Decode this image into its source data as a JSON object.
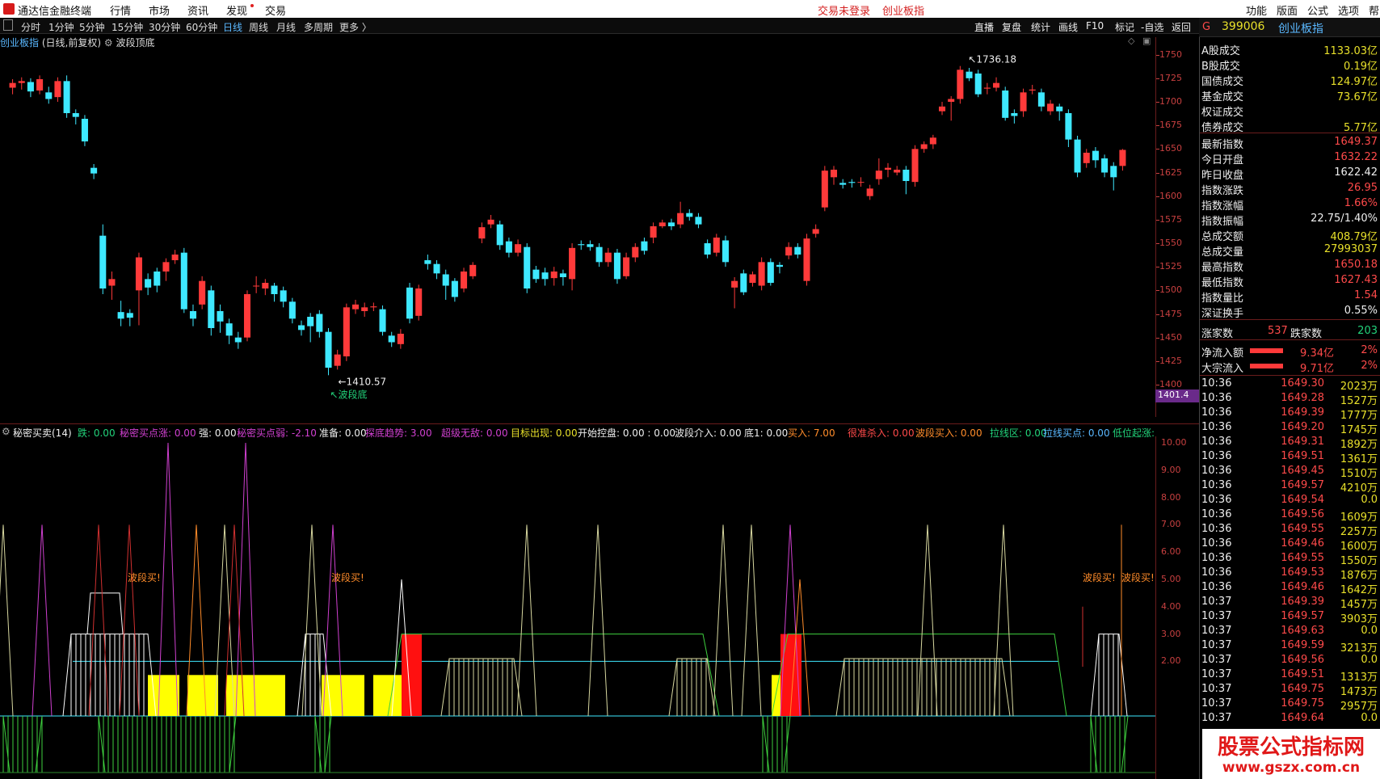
{
  "topbar": {
    "app_name": "通达信金融终端",
    "menus": [
      "行情",
      "市场",
      "资讯",
      "发现",
      "交易"
    ],
    "status_left": "交易未登录",
    "status_right": "创业板指",
    "right_menus": [
      "功能",
      "版面",
      "公式",
      "选项",
      "帮"
    ]
  },
  "periods": {
    "items": [
      "分时",
      "1分钟",
      "5分钟",
      "15分钟",
      "30分钟",
      "60分钟",
      "日线",
      "周线",
      "月线",
      "多周期",
      "更多 〉"
    ],
    "active": "日线"
  },
  "tools": [
    "直播",
    "复盘",
    "统计",
    "画线",
    "F10",
    "标记",
    "-自选",
    "返回"
  ],
  "main_chart": {
    "title_name": "创业板指",
    "title_mode": "(日线,前复权)",
    "indicator": "波段顶底",
    "high_label": "1736.18",
    "low_label": "1410.57",
    "low_note": "↖波段底",
    "price_marker": "1401.4",
    "y_labels": [
      "1750",
      "1725",
      "1700",
      "1675",
      "1650",
      "1625",
      "1600",
      "1575",
      "1550",
      "1525",
      "1500",
      "1475",
      "1450",
      "1425",
      "1400"
    ]
  },
  "chart_data": {
    "type": "candlestick",
    "ylim": [
      1400,
      1760
    ],
    "candles": [
      {
        "o": 1715,
        "c": 1720,
        "h": 1724,
        "l": 1708
      },
      {
        "o": 1720,
        "c": 1722,
        "h": 1726,
        "l": 1713
      },
      {
        "o": 1721,
        "c": 1711,
        "h": 1725,
        "l": 1705
      },
      {
        "o": 1712,
        "c": 1724,
        "h": 1728,
        "l": 1708
      },
      {
        "o": 1710,
        "c": 1703,
        "h": 1716,
        "l": 1698
      },
      {
        "o": 1705,
        "c": 1722,
        "h": 1726,
        "l": 1700
      },
      {
        "o": 1722,
        "c": 1688,
        "h": 1728,
        "l": 1683
      },
      {
        "o": 1688,
        "c": 1684,
        "h": 1692,
        "l": 1676
      },
      {
        "o": 1682,
        "c": 1658,
        "h": 1686,
        "l": 1653
      },
      {
        "o": 1630,
        "c": 1624,
        "h": 1634,
        "l": 1618
      },
      {
        "o": 1558,
        "c": 1502,
        "h": 1570,
        "l": 1496
      },
      {
        "o": 1505,
        "c": 1512,
        "h": 1520,
        "l": 1490
      },
      {
        "o": 1477,
        "c": 1470,
        "h": 1489,
        "l": 1462
      },
      {
        "o": 1476,
        "c": 1471,
        "h": 1480,
        "l": 1462
      },
      {
        "o": 1500,
        "c": 1535,
        "h": 1540,
        "l": 1463
      },
      {
        "o": 1512,
        "c": 1503,
        "h": 1518,
        "l": 1495
      },
      {
        "o": 1520,
        "c": 1505,
        "h": 1524,
        "l": 1498
      },
      {
        "o": 1520,
        "c": 1530,
        "h": 1534,
        "l": 1510
      },
      {
        "o": 1532,
        "c": 1538,
        "h": 1543,
        "l": 1528
      },
      {
        "o": 1540,
        "c": 1480,
        "h": 1545,
        "l": 1476
      },
      {
        "o": 1478,
        "c": 1470,
        "h": 1485,
        "l": 1462
      },
      {
        "o": 1485,
        "c": 1510,
        "h": 1515,
        "l": 1480
      },
      {
        "o": 1500,
        "c": 1460,
        "h": 1505,
        "l": 1452
      },
      {
        "o": 1478,
        "c": 1467,
        "h": 1485,
        "l": 1455
      },
      {
        "o": 1465,
        "c": 1452,
        "h": 1470,
        "l": 1443
      },
      {
        "o": 1450,
        "c": 1445,
        "h": 1456,
        "l": 1438
      },
      {
        "o": 1450,
        "c": 1496,
        "h": 1500,
        "l": 1446
      },
      {
        "o": 1505,
        "c": 1505,
        "h": 1515,
        "l": 1497
      },
      {
        "o": 1502,
        "c": 1508,
        "h": 1512,
        "l": 1495
      },
      {
        "o": 1505,
        "c": 1496,
        "h": 1508,
        "l": 1488
      },
      {
        "o": 1500,
        "c": 1488,
        "h": 1504,
        "l": 1482
      },
      {
        "o": 1488,
        "c": 1470,
        "h": 1492,
        "l": 1465
      },
      {
        "o": 1463,
        "c": 1458,
        "h": 1468,
        "l": 1452
      },
      {
        "o": 1472,
        "c": 1462,
        "h": 1476,
        "l": 1445
      },
      {
        "o": 1475,
        "c": 1456,
        "h": 1479,
        "l": 1450
      },
      {
        "o": 1456,
        "c": 1418,
        "h": 1460,
        "l": 1410
      },
      {
        "o": 1420,
        "c": 1432,
        "h": 1437,
        "l": 1416
      },
      {
        "o": 1430,
        "c": 1482,
        "h": 1486,
        "l": 1425
      },
      {
        "o": 1480,
        "c": 1485,
        "h": 1490,
        "l": 1475
      },
      {
        "o": 1478,
        "c": 1482,
        "h": 1487,
        "l": 1472
      },
      {
        "o": 1482,
        "c": 1483,
        "h": 1487,
        "l": 1478
      },
      {
        "o": 1480,
        "c": 1456,
        "h": 1484,
        "l": 1452
      },
      {
        "o": 1452,
        "c": 1445,
        "h": 1456,
        "l": 1440
      },
      {
        "o": 1443,
        "c": 1454,
        "h": 1459,
        "l": 1438
      },
      {
        "o": 1503,
        "c": 1470,
        "h": 1508,
        "l": 1465
      },
      {
        "o": 1473,
        "c": 1502,
        "h": 1506,
        "l": 1468
      },
      {
        "o": 1532,
        "c": 1528,
        "h": 1538,
        "l": 1522
      },
      {
        "o": 1528,
        "c": 1518,
        "h": 1532,
        "l": 1512
      },
      {
        "o": 1517,
        "c": 1505,
        "h": 1522,
        "l": 1490
      },
      {
        "o": 1510,
        "c": 1493,
        "h": 1513,
        "l": 1488
      },
      {
        "o": 1502,
        "c": 1520,
        "h": 1524,
        "l": 1498
      },
      {
        "o": 1515,
        "c": 1527,
        "h": 1530,
        "l": 1512
      },
      {
        "o": 1555,
        "c": 1567,
        "h": 1572,
        "l": 1550
      },
      {
        "o": 1570,
        "c": 1575,
        "h": 1580,
        "l": 1566
      },
      {
        "o": 1570,
        "c": 1548,
        "h": 1574,
        "l": 1543
      },
      {
        "o": 1552,
        "c": 1540,
        "h": 1556,
        "l": 1535
      },
      {
        "o": 1540,
        "c": 1549,
        "h": 1554,
        "l": 1536
      },
      {
        "o": 1546,
        "c": 1502,
        "h": 1550,
        "l": 1497
      },
      {
        "o": 1522,
        "c": 1512,
        "h": 1526,
        "l": 1508
      },
      {
        "o": 1519,
        "c": 1512,
        "h": 1524,
        "l": 1505
      },
      {
        "o": 1513,
        "c": 1520,
        "h": 1525,
        "l": 1505
      },
      {
        "o": 1518,
        "c": 1514,
        "h": 1522,
        "l": 1505
      },
      {
        "o": 1512,
        "c": 1545,
        "h": 1550,
        "l": 1500
      },
      {
        "o": 1549,
        "c": 1548,
        "h": 1553,
        "l": 1543
      },
      {
        "o": 1549,
        "c": 1546,
        "h": 1553,
        "l": 1542
      },
      {
        "o": 1546,
        "c": 1530,
        "h": 1550,
        "l": 1525
      },
      {
        "o": 1530,
        "c": 1540,
        "h": 1545,
        "l": 1525
      },
      {
        "o": 1540,
        "c": 1512,
        "h": 1544,
        "l": 1507
      },
      {
        "o": 1515,
        "c": 1535,
        "h": 1540,
        "l": 1512
      },
      {
        "o": 1535,
        "c": 1546,
        "h": 1550,
        "l": 1530
      },
      {
        "o": 1552,
        "c": 1542,
        "h": 1556,
        "l": 1538
      },
      {
        "o": 1556,
        "c": 1568,
        "h": 1572,
        "l": 1550
      },
      {
        "o": 1568,
        "c": 1572,
        "h": 1575,
        "l": 1566
      },
      {
        "o": 1572,
        "c": 1568,
        "h": 1576,
        "l": 1564
      },
      {
        "o": 1570,
        "c": 1582,
        "h": 1594,
        "l": 1566
      },
      {
        "o": 1582,
        "c": 1578,
        "h": 1586,
        "l": 1574
      },
      {
        "o": 1578,
        "c": 1570,
        "h": 1582,
        "l": 1566
      },
      {
        "o": 1550,
        "c": 1538,
        "h": 1554,
        "l": 1534
      },
      {
        "o": 1540,
        "c": 1556,
        "h": 1560,
        "l": 1536
      },
      {
        "o": 1553,
        "c": 1530,
        "h": 1558,
        "l": 1525
      },
      {
        "o": 1503,
        "c": 1510,
        "h": 1514,
        "l": 1481
      },
      {
        "o": 1518,
        "c": 1498,
        "h": 1522,
        "l": 1495
      },
      {
        "o": 1508,
        "c": 1517,
        "h": 1520,
        "l": 1504
      },
      {
        "o": 1505,
        "c": 1530,
        "h": 1535,
        "l": 1500
      },
      {
        "o": 1530,
        "c": 1508,
        "h": 1534,
        "l": 1505
      },
      {
        "o": 1527,
        "c": 1525,
        "h": 1530,
        "l": 1518
      },
      {
        "o": 1537,
        "c": 1546,
        "h": 1551,
        "l": 1533
      },
      {
        "o": 1546,
        "c": 1538,
        "h": 1550,
        "l": 1534
      },
      {
        "o": 1510,
        "c": 1555,
        "h": 1560,
        "l": 1505
      },
      {
        "o": 1560,
        "c": 1565,
        "h": 1570,
        "l": 1556
      },
      {
        "o": 1588,
        "c": 1627,
        "h": 1632,
        "l": 1584
      },
      {
        "o": 1620,
        "c": 1628,
        "h": 1632,
        "l": 1612
      },
      {
        "o": 1614,
        "c": 1612,
        "h": 1618,
        "l": 1608
      },
      {
        "o": 1615,
        "c": 1614,
        "h": 1618,
        "l": 1609
      },
      {
        "o": 1615,
        "c": 1615,
        "h": 1620,
        "l": 1610
      },
      {
        "o": 1600,
        "c": 1608,
        "h": 1612,
        "l": 1596
      },
      {
        "o": 1618,
        "c": 1627,
        "h": 1640,
        "l": 1612
      },
      {
        "o": 1628,
        "c": 1630,
        "h": 1635,
        "l": 1620
      },
      {
        "o": 1625,
        "c": 1628,
        "h": 1632,
        "l": 1622
      },
      {
        "o": 1628,
        "c": 1616,
        "h": 1632,
        "l": 1602
      },
      {
        "o": 1615,
        "c": 1650,
        "h": 1654,
        "l": 1610
      },
      {
        "o": 1650,
        "c": 1655,
        "h": 1658,
        "l": 1646
      },
      {
        "o": 1655,
        "c": 1662,
        "h": 1665,
        "l": 1650
      },
      {
        "o": 1690,
        "c": 1695,
        "h": 1700,
        "l": 1686
      },
      {
        "o": 1700,
        "c": 1703,
        "h": 1706,
        "l": 1680
      },
      {
        "o": 1703,
        "c": 1734,
        "h": 1738,
        "l": 1698
      },
      {
        "o": 1732,
        "c": 1725,
        "h": 1736,
        "l": 1722
      },
      {
        "o": 1730,
        "c": 1708,
        "h": 1734,
        "l": 1705
      },
      {
        "o": 1714,
        "c": 1715,
        "h": 1720,
        "l": 1708
      },
      {
        "o": 1715,
        "c": 1720,
        "h": 1726,
        "l": 1711
      },
      {
        "o": 1712,
        "c": 1683,
        "h": 1716,
        "l": 1680
      },
      {
        "o": 1688,
        "c": 1685,
        "h": 1692,
        "l": 1677
      },
      {
        "o": 1690,
        "c": 1710,
        "h": 1714,
        "l": 1684
      },
      {
        "o": 1712,
        "c": 1713,
        "h": 1718,
        "l": 1708
      },
      {
        "o": 1710,
        "c": 1695,
        "h": 1714,
        "l": 1690
      },
      {
        "o": 1690,
        "c": 1698,
        "h": 1702,
        "l": 1686
      },
      {
        "o": 1695,
        "c": 1690,
        "h": 1698,
        "l": 1680
      },
      {
        "o": 1688,
        "c": 1660,
        "h": 1692,
        "l": 1652
      },
      {
        "o": 1660,
        "c": 1625,
        "h": 1664,
        "l": 1620
      },
      {
        "o": 1635,
        "c": 1646,
        "h": 1650,
        "l": 1630
      },
      {
        "o": 1648,
        "c": 1638,
        "h": 1652,
        "l": 1630
      },
      {
        "o": 1640,
        "c": 1625,
        "h": 1644,
        "l": 1620
      },
      {
        "o": 1632,
        "c": 1620,
        "h": 1636,
        "l": 1606
      },
      {
        "o": 1632,
        "c": 1649,
        "h": 1650,
        "l": 1627
      }
    ]
  },
  "indicator": {
    "title": "秘密买卖(14)",
    "legend": [
      {
        "t": "跌: 0.00",
        "c": "#22d27a"
      },
      {
        "t": "秘密买点涨: 0.00",
        "c": "#d040d0"
      },
      {
        "t": "强: 0.00",
        "c": "#eee"
      },
      {
        "t": "秘密买点弱: -2.10",
        "c": "#d040d0"
      },
      {
        "t": "准备: 0.00",
        "c": "#eee"
      },
      {
        "t": "探底趋势: 3.00",
        "c": "#d040d0"
      },
      {
        "t": "超级无敌: 0.00",
        "c": "#d040d0"
      },
      {
        "t": "目标出现: 0.00",
        "c": "#e8e02a"
      },
      {
        "t": "开始控盘: 0.00 : 0.00",
        "c": "#eee"
      },
      {
        "t": "波段介入: 0.00",
        "c": "#eee"
      },
      {
        "t": "底1: 0.00",
        "c": "#eee"
      },
      {
        "t": "买入: 7.00",
        "c": "#ff8c2a"
      },
      {
        "t": "很准杀入: 0.00",
        "c": "#ff4a4a"
      },
      {
        "t": "波段买入: 0.00",
        "c": "#ff8c2a"
      },
      {
        "t": "拉线区: 0.00",
        "c": "#22d27a"
      },
      {
        "t": "拉线买点: 0.00",
        "c": "#5ab8ff"
      },
      {
        "t": "低位起涨:",
        "c": "#22d27a"
      }
    ],
    "buy_labels": [
      "波段买!",
      "波段买!",
      "波段买!",
      "波段买!"
    ],
    "y_labels": [
      "10.00",
      "9.00",
      "8.00",
      "7.00",
      "6.00",
      "5.00",
      "4.00",
      "3.00",
      "2.00"
    ]
  },
  "quote": {
    "code": "399006",
    "name": "创业板指",
    "g_label": "G",
    "rows": [
      {
        "l": "A股成交",
        "v": "1133.03亿",
        "c": "yl"
      },
      {
        "l": "B股成交",
        "v": "0.19亿",
        "c": "yl"
      },
      {
        "l": "国债成交",
        "v": "124.97亿",
        "c": "yl"
      },
      {
        "l": "基金成交",
        "v": "73.67亿",
        "c": "yl"
      },
      {
        "l": "权证成交",
        "v": "",
        "c": "yl"
      },
      {
        "l": "债券成交",
        "v": "5.77亿",
        "c": "yl"
      },
      {
        "l": "最新指数",
        "v": "1649.37",
        "c": "up"
      },
      {
        "l": "今日开盘",
        "v": "1632.22",
        "c": "up"
      },
      {
        "l": "昨日收盘",
        "v": "1622.42",
        "c": "wh"
      },
      {
        "l": "指数涨跌",
        "v": "26.95",
        "c": "up"
      },
      {
        "l": "指数涨幅",
        "v": "1.66%",
        "c": "up"
      },
      {
        "l": "指数振幅",
        "v": "22.75/1.40%",
        "c": "wh"
      },
      {
        "l": "总成交额",
        "v": "408.79亿",
        "c": "yl"
      },
      {
        "l": "总成交量",
        "v": "27993037",
        "c": "yl"
      },
      {
        "l": "最高指数",
        "v": "1650.18",
        "c": "up"
      },
      {
        "l": "最低指数",
        "v": "1627.43",
        "c": "up"
      },
      {
        "l": "指数量比",
        "v": "1.54",
        "c": "up"
      },
      {
        "l": "深证换手",
        "v": "0.55%",
        "c": "wh"
      }
    ],
    "up_count_label": "涨家数",
    "up_count": "537",
    "down_count_label": "跌家数",
    "down_count": "203",
    "flows": [
      {
        "l": "净流入额",
        "v": "9.34亿",
        "p": "2%",
        "f": 0.46
      },
      {
        "l": "大宗流入",
        "v": "9.71亿",
        "p": "2%",
        "f": 0.46
      }
    ],
    "ticks": [
      [
        "10:36",
        "1649.30",
        "2023万"
      ],
      [
        "10:36",
        "1649.28",
        "1527万"
      ],
      [
        "10:36",
        "1649.39",
        "1777万"
      ],
      [
        "10:36",
        "1649.20",
        "1745万"
      ],
      [
        "10:36",
        "1649.31",
        "1892万"
      ],
      [
        "10:36",
        "1649.51",
        "1361万"
      ],
      [
        "10:36",
        "1649.45",
        "1510万"
      ],
      [
        "10:36",
        "1649.57",
        "4210万"
      ],
      [
        "10:36",
        "1649.54",
        "0.0"
      ],
      [
        "10:36",
        "1649.56",
        "1609万"
      ],
      [
        "10:36",
        "1649.55",
        "2257万"
      ],
      [
        "10:36",
        "1649.46",
        "1600万"
      ],
      [
        "10:36",
        "1649.55",
        "1550万"
      ],
      [
        "10:36",
        "1649.53",
        "1876万"
      ],
      [
        "10:36",
        "1649.46",
        "1642万"
      ],
      [
        "10:37",
        "1649.39",
        "1457万"
      ],
      [
        "10:37",
        "1649.57",
        "3903万"
      ],
      [
        "10:37",
        "1649.63",
        "0.0"
      ],
      [
        "10:37",
        "1649.59",
        "3213万"
      ],
      [
        "10:37",
        "1649.56",
        "0.0"
      ],
      [
        "10:37",
        "1649.51",
        "1313万"
      ],
      [
        "10:37",
        "1649.75",
        "1473万"
      ],
      [
        "10:37",
        "1649.75",
        "2957万"
      ],
      [
        "10:37",
        "1649.64",
        "0.0"
      ]
    ]
  },
  "watermark": {
    "line1": "股票公式指标网",
    "line2": "www.gszx.com.cn"
  }
}
